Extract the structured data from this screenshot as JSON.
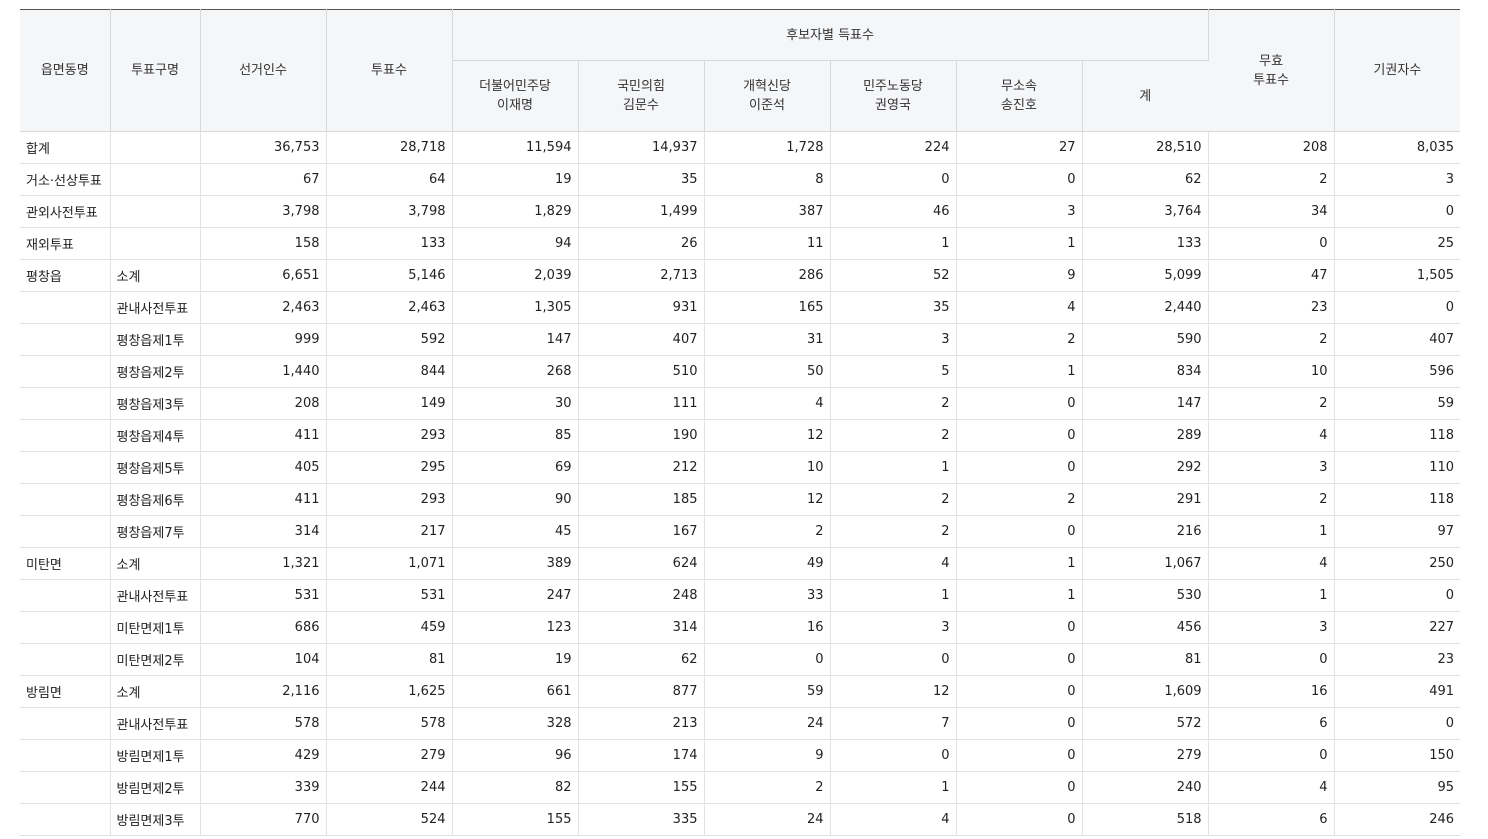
{
  "headers": {
    "region": "읍면동명",
    "vote_type": "투표구명",
    "electors": "선거인수",
    "votes": "투표수",
    "candidate_group": "후보자별 득표수",
    "candidates": [
      {
        "party": "더불어민주당",
        "name": "이재명"
      },
      {
        "party": "국민의힘",
        "name": "김문수"
      },
      {
        "party": "개혁신당",
        "name": "이준석"
      },
      {
        "party": "민주노동당",
        "name": "권영국"
      },
      {
        "party": "무소속",
        "name": "송진호"
      }
    ],
    "total": "계",
    "invalid_line1": "무효",
    "invalid_line2": "투표수",
    "abstain": "기권자수"
  },
  "rows": [
    [
      "합계",
      "",
      "36,753",
      "28,718",
      "11,594",
      "14,937",
      "1,728",
      "224",
      "27",
      "28,510",
      "208",
      "8,035"
    ],
    [
      "거소·선상투표",
      "",
      "67",
      "64",
      "19",
      "35",
      "8",
      "0",
      "0",
      "62",
      "2",
      "3"
    ],
    [
      "관외사전투표",
      "",
      "3,798",
      "3,798",
      "1,829",
      "1,499",
      "387",
      "46",
      "3",
      "3,764",
      "34",
      "0"
    ],
    [
      "재외투표",
      "",
      "158",
      "133",
      "94",
      "26",
      "11",
      "1",
      "1",
      "133",
      "0",
      "25"
    ],
    [
      "평창읍",
      "소계",
      "6,651",
      "5,146",
      "2,039",
      "2,713",
      "286",
      "52",
      "9",
      "5,099",
      "47",
      "1,505"
    ],
    [
      "",
      "관내사전투표",
      "2,463",
      "2,463",
      "1,305",
      "931",
      "165",
      "35",
      "4",
      "2,440",
      "23",
      "0"
    ],
    [
      "",
      "평창읍제1투",
      "999",
      "592",
      "147",
      "407",
      "31",
      "3",
      "2",
      "590",
      "2",
      "407"
    ],
    [
      "",
      "평창읍제2투",
      "1,440",
      "844",
      "268",
      "510",
      "50",
      "5",
      "1",
      "834",
      "10",
      "596"
    ],
    [
      "",
      "평창읍제3투",
      "208",
      "149",
      "30",
      "111",
      "4",
      "2",
      "0",
      "147",
      "2",
      "59"
    ],
    [
      "",
      "평창읍제4투",
      "411",
      "293",
      "85",
      "190",
      "12",
      "2",
      "0",
      "289",
      "4",
      "118"
    ],
    [
      "",
      "평창읍제5투",
      "405",
      "295",
      "69",
      "212",
      "10",
      "1",
      "0",
      "292",
      "3",
      "110"
    ],
    [
      "",
      "평창읍제6투",
      "411",
      "293",
      "90",
      "185",
      "12",
      "2",
      "2",
      "291",
      "2",
      "118"
    ],
    [
      "",
      "평창읍제7투",
      "314",
      "217",
      "45",
      "167",
      "2",
      "2",
      "0",
      "216",
      "1",
      "97"
    ],
    [
      "미탄면",
      "소계",
      "1,321",
      "1,071",
      "389",
      "624",
      "49",
      "4",
      "1",
      "1,067",
      "4",
      "250"
    ],
    [
      "",
      "관내사전투표",
      "531",
      "531",
      "247",
      "248",
      "33",
      "1",
      "1",
      "530",
      "1",
      "0"
    ],
    [
      "",
      "미탄면제1투",
      "686",
      "459",
      "123",
      "314",
      "16",
      "3",
      "0",
      "456",
      "3",
      "227"
    ],
    [
      "",
      "미탄면제2투",
      "104",
      "81",
      "19",
      "62",
      "0",
      "0",
      "0",
      "81",
      "0",
      "23"
    ],
    [
      "방림면",
      "소계",
      "2,116",
      "1,625",
      "661",
      "877",
      "59",
      "12",
      "0",
      "1,609",
      "16",
      "491"
    ],
    [
      "",
      "관내사전투표",
      "578",
      "578",
      "328",
      "213",
      "24",
      "7",
      "0",
      "572",
      "6",
      "0"
    ],
    [
      "",
      "방림면제1투",
      "429",
      "279",
      "96",
      "174",
      "9",
      "0",
      "0",
      "279",
      "0",
      "150"
    ],
    [
      "",
      "방림면제2투",
      "339",
      "244",
      "82",
      "155",
      "2",
      "1",
      "0",
      "240",
      "4",
      "95"
    ],
    [
      "",
      "방림면제3투",
      "770",
      "524",
      "155",
      "335",
      "24",
      "4",
      "0",
      "518",
      "6",
      "246"
    ]
  ]
}
